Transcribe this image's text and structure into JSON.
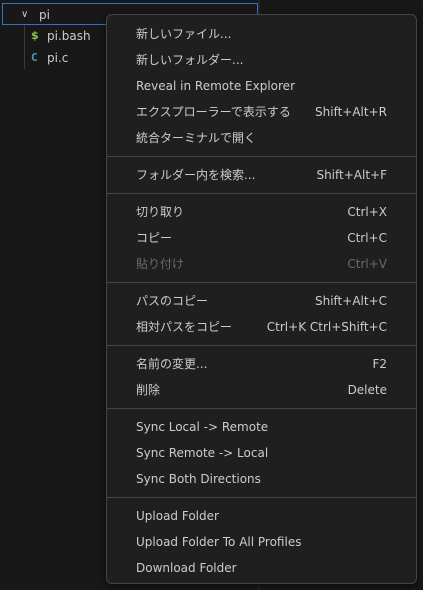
{
  "explorer": {
    "folder": {
      "name": "pi"
    },
    "files": [
      {
        "name": "pi.bash",
        "icon": "$"
      },
      {
        "name": "pi.c",
        "icon": "C"
      }
    ]
  },
  "menu": {
    "groups": [
      [
        {
          "label": "新しいファイル...",
          "shortcut": "",
          "enabled": true
        },
        {
          "label": "新しいフォルダー...",
          "shortcut": "",
          "enabled": true
        },
        {
          "label": "Reveal in Remote Explorer",
          "shortcut": "",
          "enabled": true
        },
        {
          "label": "エクスプローラーで表示する",
          "shortcut": "Shift+Alt+R",
          "enabled": true
        },
        {
          "label": "統合ターミナルで開く",
          "shortcut": "",
          "enabled": true
        }
      ],
      [
        {
          "label": "フォルダー内を検索...",
          "shortcut": "Shift+Alt+F",
          "enabled": true
        }
      ],
      [
        {
          "label": "切り取り",
          "shortcut": "Ctrl+X",
          "enabled": true
        },
        {
          "label": "コピー",
          "shortcut": "Ctrl+C",
          "enabled": true
        },
        {
          "label": "貼り付け",
          "shortcut": "Ctrl+V",
          "enabled": false
        }
      ],
      [
        {
          "label": "パスのコピー",
          "shortcut": "Shift+Alt+C",
          "enabled": true
        },
        {
          "label": "相対パスをコピー",
          "shortcut": "Ctrl+K Ctrl+Shift+C",
          "enabled": true
        }
      ],
      [
        {
          "label": "名前の変更...",
          "shortcut": "F2",
          "enabled": true
        },
        {
          "label": "削除",
          "shortcut": "Delete",
          "enabled": true
        }
      ],
      [
        {
          "label": "Sync Local -> Remote",
          "shortcut": "",
          "enabled": true
        },
        {
          "label": "Sync Remote -> Local",
          "shortcut": "",
          "enabled": true
        },
        {
          "label": "Sync Both Directions",
          "shortcut": "",
          "enabled": true
        }
      ],
      [
        {
          "label": "Upload Folder",
          "shortcut": "",
          "enabled": true
        },
        {
          "label": "Upload Folder To All Profiles",
          "shortcut": "",
          "enabled": true
        },
        {
          "label": "Download Folder",
          "shortcut": "",
          "enabled": true
        }
      ]
    ]
  }
}
